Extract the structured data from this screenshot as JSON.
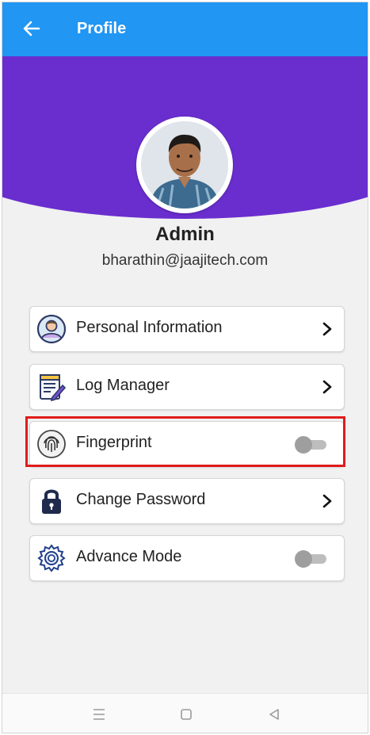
{
  "header": {
    "title": "Profile"
  },
  "profile": {
    "name": "Admin",
    "email": "bharathin@jaajitech.com"
  },
  "menu": [
    {
      "label": "Personal Information",
      "icon": "person-icon",
      "control": "chevron"
    },
    {
      "label": "Log Manager",
      "icon": "notepad-icon",
      "control": "chevron"
    },
    {
      "label": "Fingerprint",
      "icon": "fingerprint-icon",
      "control": "toggle",
      "enabled": false,
      "highlighted": true
    },
    {
      "label": "Change Password",
      "icon": "lock-icon",
      "control": "chevron"
    },
    {
      "label": "Advance Mode",
      "icon": "gear-icon",
      "control": "toggle",
      "enabled": false
    }
  ],
  "colors": {
    "appbar": "#2196f3",
    "banner": "#6a2ecf",
    "highlight": "#e01b1b"
  },
  "navbar": {
    "items": [
      "menu-icon",
      "home-icon",
      "back-triangle-icon"
    ]
  }
}
